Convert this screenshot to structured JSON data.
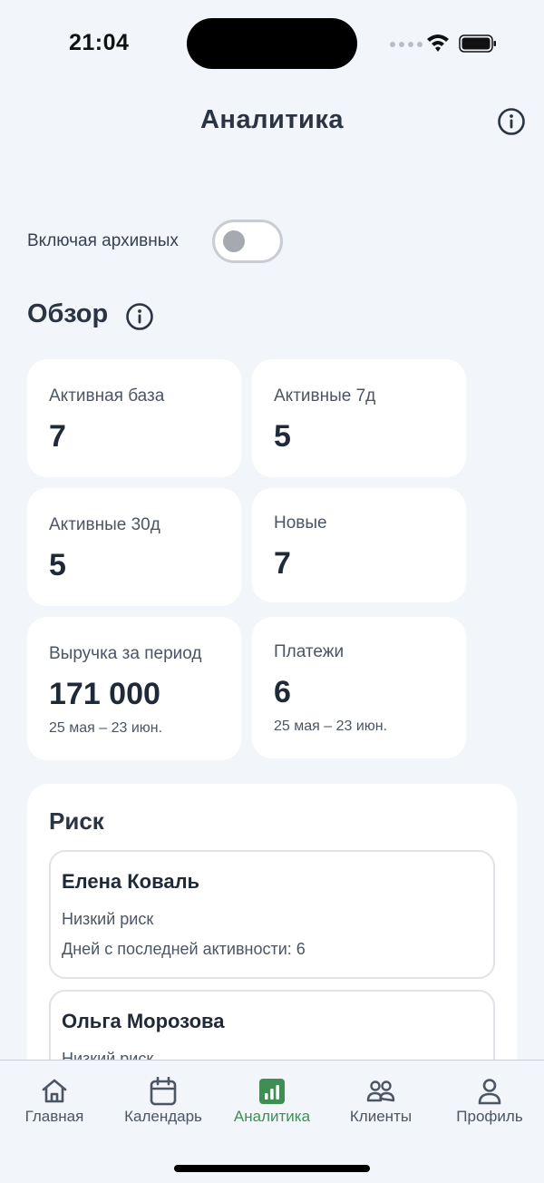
{
  "status_bar": {
    "time": "21:04"
  },
  "header": {
    "title": "Аналитика",
    "info_icon": "info-icon"
  },
  "filters": {
    "include_archived_label": "Включая архивных",
    "include_archived_on": false
  },
  "overview": {
    "title": "Обзор",
    "metrics": [
      {
        "label": "Активная база",
        "value": "7"
      },
      {
        "label": "Активные 7д",
        "value": "5"
      },
      {
        "label": "Активные 30д",
        "value": "5"
      },
      {
        "label": "Новые",
        "value": "7"
      },
      {
        "label": "Выручка за период",
        "value": "171 000",
        "period": "25 мая – 23 июн."
      },
      {
        "label": "Платежи",
        "value": "6",
        "period": "25 мая – 23 июн."
      }
    ]
  },
  "risk": {
    "title": "Риск",
    "clients": [
      {
        "name": "Елена Коваль",
        "level": "Низкий риск",
        "days_since_activity": "Дней с последней активности: 6"
      },
      {
        "name": "Ольга Морозова",
        "level": "Низкий риск"
      }
    ]
  },
  "tab_bar": {
    "active_color": "#3f8f54",
    "tabs": [
      {
        "label": "Главная",
        "icon": "home-icon"
      },
      {
        "label": "Календарь",
        "icon": "calendar-icon"
      },
      {
        "label": "Аналитика",
        "icon": "analytics-icon",
        "active": true
      },
      {
        "label": "Клиенты",
        "icon": "clients-icon"
      },
      {
        "label": "Профиль",
        "icon": "profile-icon"
      }
    ]
  }
}
